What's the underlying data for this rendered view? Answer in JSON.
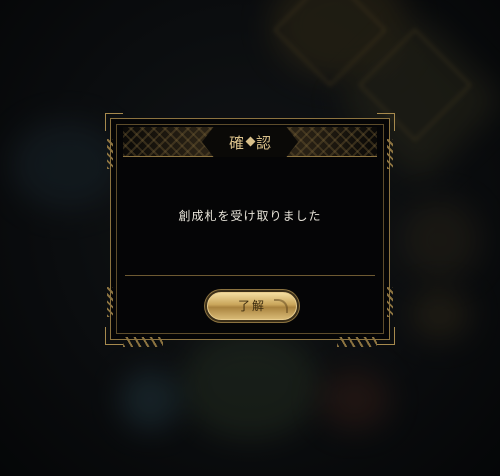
{
  "dialog": {
    "title": "確認",
    "message": "創成札を受け取りました",
    "ok_label": "了解"
  },
  "colors": {
    "gold_accent": "#8c7340",
    "title_text": "#d9c08a",
    "button_gold": "#c9a55a",
    "dialog_bg": "#050506"
  },
  "icons": [
    "title-gem-icon",
    "corner-ornament-icon"
  ]
}
